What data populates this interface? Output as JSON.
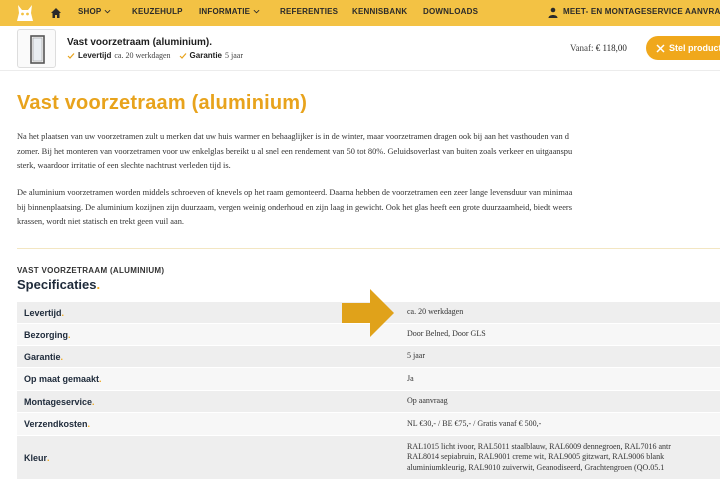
{
  "nav": {
    "items": [
      {
        "label": "SHOP",
        "has_dropdown": true
      },
      {
        "label": "KEUZEHULP",
        "has_dropdown": false
      },
      {
        "label": "INFORMATIE",
        "has_dropdown": true
      },
      {
        "label": "REFERENTIES",
        "has_dropdown": false
      },
      {
        "label": "KENNISBANK",
        "has_dropdown": false
      },
      {
        "label": "DOWNLOADS",
        "has_dropdown": false
      }
    ],
    "service_label": "MEET- EN MONTAGESERVICE AANVRAG",
    "bar_color": "#f3c244"
  },
  "product_bar": {
    "title": "Vast voorzetraam (aluminium).",
    "levertijd_label": "Levertijd",
    "levertijd_value": "ca. 20 werkdagen",
    "garantie_label": "Garantie",
    "garantie_value": "5 jaar",
    "price_prefix": "Vanaf:",
    "price": "€ 118,00",
    "cta_label": "Stel product"
  },
  "content": {
    "heading": "Vast voorzetraam (aluminium)",
    "paragraph1": [
      "Na het plaatsen van uw voorzetramen zult u merken dat uw huis warmer en behaaglijker is in de winter, maar voorzetramen dragen ook bij aan het vasthouden van d",
      "zomer. Bij het monteren van voorzetramen voor uw enkelglas bereikt u al snel een rendement van 50 tot 80%. Geluidsoverlast van buiten zoals verkeer en uitgaanspu",
      "sterk, waardoor irritatie of een slechte nachtrust verleden tijd is."
    ],
    "paragraph2": [
      "De aluminium voorzetramen worden middels schroeven of knevels op het raam gemonteerd. Daarna hebben de voorzetramen een zeer lange levensduur van minimaa",
      "bij binnenplaatsing. De aluminium kozijnen zijn duurzaam, vergen weinig onderhoud en zijn laag in gewicht. Ook het glas heeft een grote duurzaamheid, biedt weers",
      "krassen, wordt niet statisch en trekt geen vuil aan."
    ]
  },
  "specs": {
    "eyebrow": "VAST VOORZETRAAM (ALUMINIUM)",
    "title": "Specificaties",
    "rows": [
      {
        "key": "Levertijd",
        "value": [
          "ca. 20 werkdagen"
        ]
      },
      {
        "key": "Bezorging",
        "value": [
          "Door Belned, Door GLS"
        ]
      },
      {
        "key": "Garantie",
        "value": [
          "5 jaar"
        ]
      },
      {
        "key": "Op maat gemaakt",
        "value": [
          "Ja"
        ]
      },
      {
        "key": "Montageservice",
        "value": [
          "Op aanvraag"
        ]
      },
      {
        "key": "Verzendkosten",
        "value": [
          "NL €30,- / BE €75,- / Gratis vanaf € 500,-"
        ]
      },
      {
        "key": "Kleur",
        "value": [
          "RAL1015 licht ivoor, RAL5011 staalblauw, RAL6009 dennegroen, RAL7016 antr",
          "RAL8014 sepiabruin, RAL9001 creme wit, RAL9005 gitzwart, RAL9006 blank",
          "aluminiumkleurig, RAL9010 zuiverwit, Geanodiseerd, Grachtengroen (QO.05.1"
        ]
      }
    ]
  },
  "colors": {
    "accent": "#f0a81c",
    "heading": "#e8a31c",
    "arrow": "#e0a21a"
  }
}
